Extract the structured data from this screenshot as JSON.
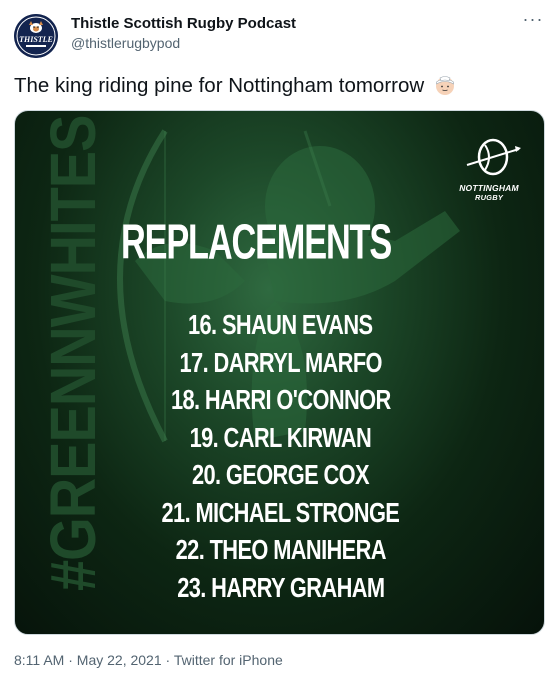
{
  "author": {
    "name": "Thistle Scottish Rugby Podcast",
    "handle": "@thistlerugbypod",
    "avatar_label": "THISTLE"
  },
  "tweet": {
    "text": "The king riding pine for Nottingham tomorrow",
    "emoji_icon": "face-with-head-bandage-emoji"
  },
  "media": {
    "vertical_tag": "#GREENNWHITES",
    "club_name": "NOTTINGHAM",
    "club_sub": "RUGBY",
    "heading": "REPLACEMENTS",
    "players": [
      "16. SHAUN EVANS",
      "17. DARRYL MARFO",
      "18. HARRI O'CONNOR",
      "19. CARL KIRWAN",
      "20. GEORGE COX",
      "21. MICHAEL STRONGE",
      "22. THEO MANIHERA",
      "23. HARRY GRAHAM"
    ]
  },
  "meta": {
    "time": "8:11 AM",
    "sep1": " · ",
    "date": "May 22, 2021",
    "sep2": " · ",
    "source": "Twitter for iPhone"
  },
  "colors": {
    "text": "#0f1419",
    "secondary": "#536471",
    "media_bg": "#0d2613",
    "avatar_bg": "#13244f"
  }
}
